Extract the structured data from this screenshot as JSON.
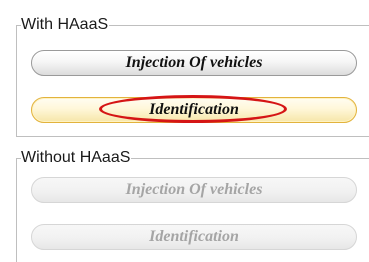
{
  "groups": {
    "with_haaas": {
      "legend": "With HAaaS",
      "injection_label": "Injection Of vehicles",
      "identification_label": "Identification"
    },
    "without_haaas": {
      "legend": "Without HAaaS",
      "injection_label": "Injection Of vehicles",
      "identification_label": "Identification"
    }
  },
  "colors": {
    "highlight": "#d51515",
    "focus_border": "#e2b33c",
    "disabled_text": "#a5a5a5",
    "group_border": "#bfbfbf"
  }
}
